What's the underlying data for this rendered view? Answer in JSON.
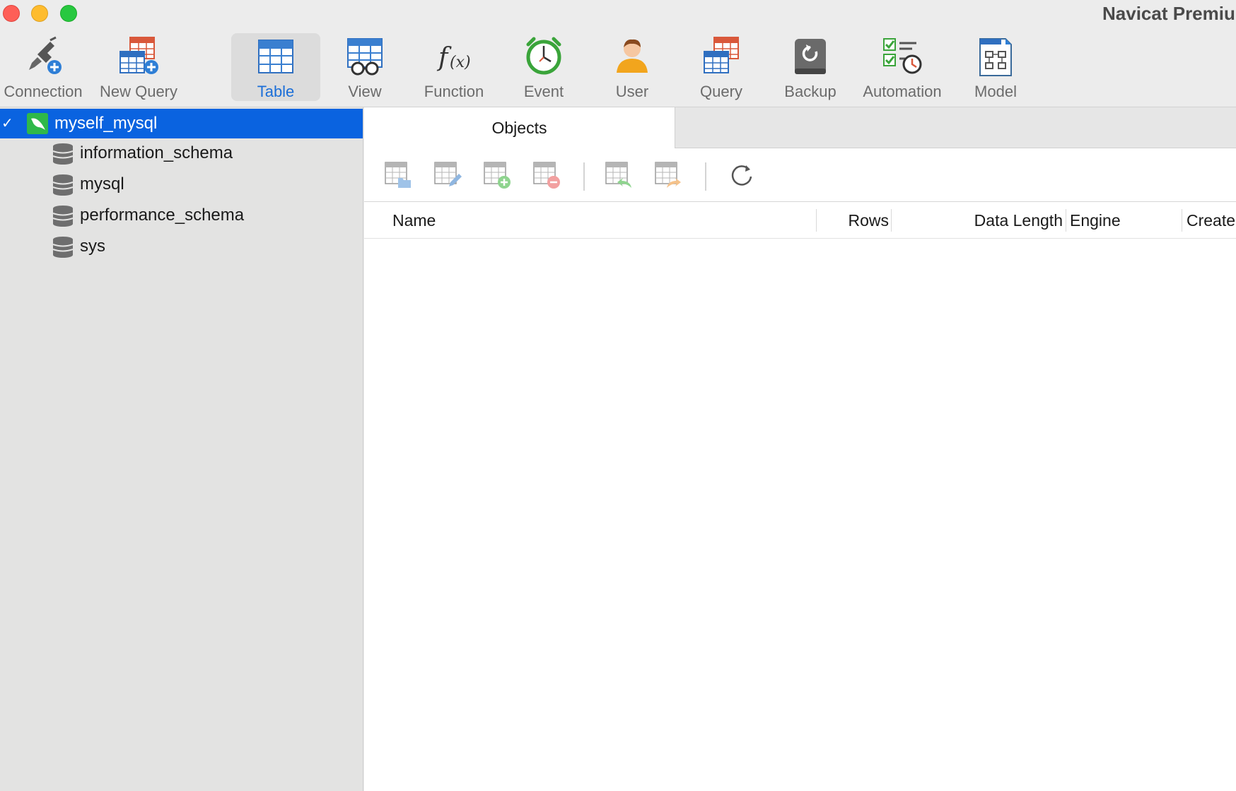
{
  "window": {
    "title": "Navicat Premiu"
  },
  "toolbar": {
    "items": [
      {
        "label": "Connection",
        "icon": "connection-plug-icon"
      },
      {
        "label": "New Query",
        "icon": "new-query-icon"
      },
      {
        "label": "Table",
        "icon": "table-icon",
        "active": true
      },
      {
        "label": "View",
        "icon": "view-icon"
      },
      {
        "label": "Function",
        "icon": "function-fx-icon"
      },
      {
        "label": "Event",
        "icon": "alarm-clock-icon"
      },
      {
        "label": "User",
        "icon": "user-icon"
      },
      {
        "label": "Query",
        "icon": "query-icon"
      },
      {
        "label": "Backup",
        "icon": "backup-icon"
      },
      {
        "label": "Automation",
        "icon": "automation-checklist-icon"
      },
      {
        "label": "Model",
        "icon": "model-diagram-icon"
      }
    ]
  },
  "sidebar": {
    "connection": {
      "label": "myself_mysql",
      "icon": "mysql-dolphin-icon",
      "expanded": true
    },
    "databases": [
      {
        "label": "information_schema",
        "icon": "database-icon"
      },
      {
        "label": "mysql",
        "icon": "database-icon"
      },
      {
        "label": "performance_schema",
        "icon": "database-icon"
      },
      {
        "label": "sys",
        "icon": "database-icon"
      }
    ]
  },
  "main": {
    "tabs": [
      {
        "label": "Objects"
      }
    ],
    "object_toolbar": [
      {
        "icon": "open-table-icon"
      },
      {
        "icon": "design-table-icon"
      },
      {
        "icon": "new-table-icon"
      },
      {
        "icon": "delete-table-icon"
      },
      {
        "icon": "import-wizard-icon"
      },
      {
        "icon": "export-wizard-icon"
      },
      {
        "icon": "refresh-icon"
      }
    ],
    "columns": [
      "Name",
      "Rows",
      "Data Length",
      "Engine",
      "Create"
    ]
  },
  "colors": {
    "accent": "#0a63e0",
    "active_label": "#1a6ed8",
    "sidebar_bg": "#e3e3e2"
  }
}
